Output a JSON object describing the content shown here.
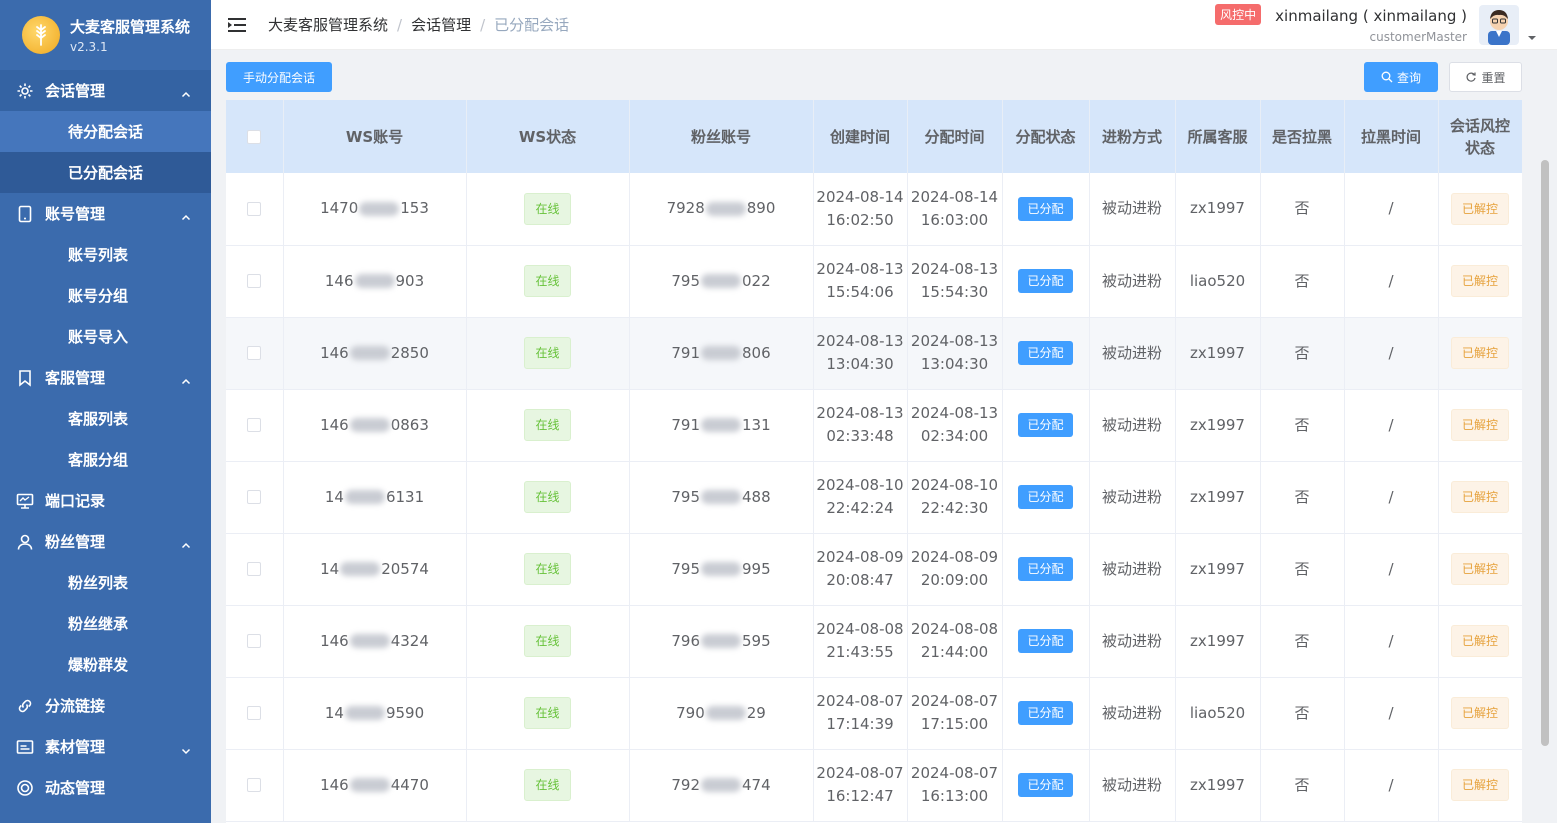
{
  "app": {
    "title": "大麦客服管理系统",
    "version": "v2.3.1"
  },
  "sidebar": {
    "groups": [
      {
        "label": "会话管理",
        "icon": "gear-icon",
        "expanded": true,
        "items": [
          "待分配会话",
          "已分配会话"
        ]
      },
      {
        "label": "账号管理",
        "icon": "tablet-icon",
        "expanded": true,
        "items": [
          "账号列表",
          "账号分组",
          "账号导入"
        ]
      },
      {
        "label": "客服管理",
        "icon": "bookmark-icon",
        "expanded": true,
        "items": [
          "客服列表",
          "客服分组"
        ]
      },
      {
        "label": "端口记录",
        "icon": "monitor-icon",
        "expanded": false,
        "items": []
      },
      {
        "label": "粉丝管理",
        "icon": "user-icon",
        "expanded": true,
        "items": [
          "粉丝列表",
          "粉丝继承",
          "爆粉群发"
        ]
      },
      {
        "label": "分流链接",
        "icon": "link-icon",
        "expanded": false,
        "items": []
      },
      {
        "label": "素材管理",
        "icon": "image-icon",
        "expanded": false,
        "collapsible": true,
        "items": []
      },
      {
        "label": "动态管理",
        "icon": "circle-icon",
        "expanded": false,
        "items": []
      }
    ]
  },
  "header": {
    "breadcrumb": [
      "大麦客服管理系统",
      "会话管理",
      "已分配会话"
    ],
    "risk_badge": "风控中",
    "user_name": "xinmailang ( xinmailang )",
    "user_role": "customerMaster"
  },
  "toolbar": {
    "assign_label": "手动分配会话",
    "query_label": "查询",
    "reset_label": "重置"
  },
  "table": {
    "columns": [
      "",
      "WS账号",
      "WS状态",
      "粉丝账号",
      "创建时间",
      "分配时间",
      "分配状态",
      "进粉方式",
      "所属客服",
      "是否拉黑",
      "拉黑时间",
      "会话风控\n状态"
    ],
    "rows": [
      {
        "ws_prefix": "1470",
        "ws_suffix": "153",
        "status": "在线",
        "fan_prefix": "7928",
        "fan_suffix": "890",
        "created_date": "2024-08-14",
        "created_time": "16:02:50",
        "assigned_date": "2024-08-14",
        "assigned_time": "16:03:00",
        "assign_status": "已分配",
        "method": "被动进粉",
        "agent": "zx1997",
        "blocked": "否",
        "blocked_time": "/",
        "risk": "已解控"
      },
      {
        "ws_prefix": "146",
        "ws_suffix": "903",
        "status": "在线",
        "fan_prefix": "795",
        "fan_suffix": "022",
        "created_date": "2024-08-13",
        "created_time": "15:54:06",
        "assigned_date": "2024-08-13",
        "assigned_time": "15:54:30",
        "assign_status": "已分配",
        "method": "被动进粉",
        "agent": "liao520",
        "blocked": "否",
        "blocked_time": "/",
        "risk": "已解控"
      },
      {
        "ws_prefix": "146",
        "ws_suffix": "2850",
        "status": "在线",
        "fan_prefix": "791",
        "fan_suffix": "806",
        "created_date": "2024-08-13",
        "created_time": "13:04:30",
        "assigned_date": "2024-08-13",
        "assigned_time": "13:04:30",
        "assign_status": "已分配",
        "method": "被动进粉",
        "agent": "zx1997",
        "blocked": "否",
        "blocked_time": "/",
        "risk": "已解控"
      },
      {
        "ws_prefix": "146",
        "ws_suffix": "0863",
        "status": "在线",
        "fan_prefix": "791",
        "fan_suffix": "131",
        "created_date": "2024-08-13",
        "created_time": "02:33:48",
        "assigned_date": "2024-08-13",
        "assigned_time": "02:34:00",
        "assign_status": "已分配",
        "method": "被动进粉",
        "agent": "zx1997",
        "blocked": "否",
        "blocked_time": "/",
        "risk": "已解控"
      },
      {
        "ws_prefix": "14",
        "ws_suffix": "6131",
        "status": "在线",
        "fan_prefix": "795",
        "fan_suffix": "488",
        "created_date": "2024-08-10",
        "created_time": "22:42:24",
        "assigned_date": "2024-08-10",
        "assigned_time": "22:42:30",
        "assign_status": "已分配",
        "method": "被动进粉",
        "agent": "zx1997",
        "blocked": "否",
        "blocked_time": "/",
        "risk": "已解控"
      },
      {
        "ws_prefix": "14",
        "ws_suffix": "20574",
        "status": "在线",
        "fan_prefix": "795",
        "fan_suffix": "995",
        "created_date": "2024-08-09",
        "created_time": "20:08:47",
        "assigned_date": "2024-08-09",
        "assigned_time": "20:09:00",
        "assign_status": "已分配",
        "method": "被动进粉",
        "agent": "zx1997",
        "blocked": "否",
        "blocked_time": "/",
        "risk": "已解控"
      },
      {
        "ws_prefix": "146",
        "ws_suffix": "4324",
        "status": "在线",
        "fan_prefix": "796",
        "fan_suffix": "595",
        "created_date": "2024-08-08",
        "created_time": "21:43:55",
        "assigned_date": "2024-08-08",
        "assigned_time": "21:44:00",
        "assign_status": "已分配",
        "method": "被动进粉",
        "agent": "zx1997",
        "blocked": "否",
        "blocked_time": "/",
        "risk": "已解控"
      },
      {
        "ws_prefix": "14",
        "ws_suffix": "9590",
        "status": "在线",
        "fan_prefix": "790",
        "fan_suffix": "29",
        "created_date": "2024-08-07",
        "created_time": "17:14:39",
        "assigned_date": "2024-08-07",
        "assigned_time": "17:15:00",
        "assign_status": "已分配",
        "method": "被动进粉",
        "agent": "liao520",
        "blocked": "否",
        "blocked_time": "/",
        "risk": "已解控"
      },
      {
        "ws_prefix": "146",
        "ws_suffix": "4470",
        "status": "在线",
        "fan_prefix": "792",
        "fan_suffix": "474",
        "created_date": "2024-08-07",
        "created_time": "16:12:47",
        "assigned_date": "2024-08-07",
        "assigned_time": "16:13:00",
        "assign_status": "已分配",
        "method": "被动进粉",
        "agent": "zx1997",
        "blocked": "否",
        "blocked_time": "/",
        "risk": "已解控"
      }
    ]
  },
  "colors": {
    "sidebar_bg": "#3b6bad",
    "header_row_bg": "#d6e6fa",
    "primary": "#409eff",
    "success": "#67c23a",
    "warning": "#e6a23c",
    "danger": "#f56c6c"
  }
}
